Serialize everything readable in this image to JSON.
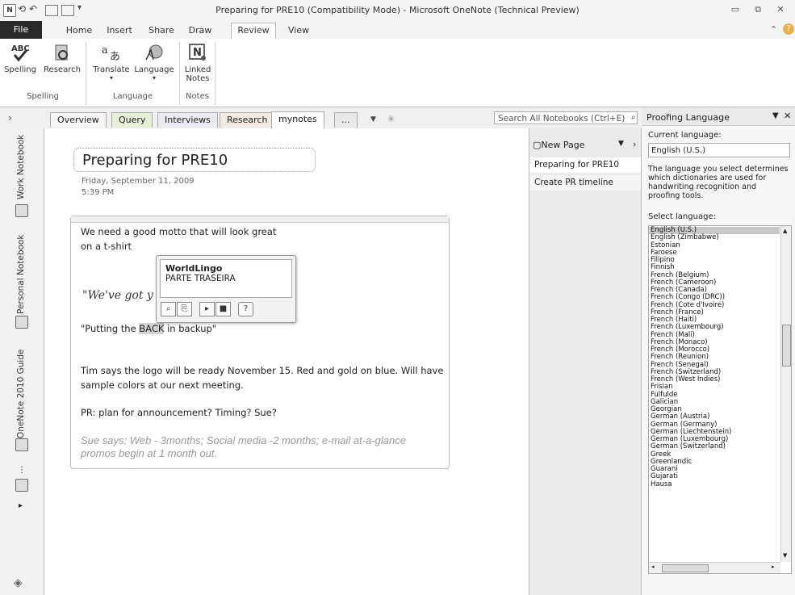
{
  "titlebar": {
    "title": "Preparing for PRE10 (Compatibility Mode) - Microsoft OneNote (Technical Preview)",
    "app_icon": "N",
    "win_minimize": "▭",
    "win_restore": "⧉",
    "win_close": "✕"
  },
  "ribbon_tabs": [
    "File",
    "Home",
    "Insert",
    "Share",
    "Draw",
    "Review",
    "View"
  ],
  "active_tab": "Review",
  "ribbon": {
    "spelling": "Spelling",
    "research": "Research",
    "translate": "Translate",
    "language": "Language",
    "linked_notes": "Linked Notes",
    "group_spelling": "Spelling",
    "group_language": "Language",
    "group_notes": "Notes"
  },
  "section_tabs": [
    "Overview",
    "Query",
    "Interviews",
    "Research",
    "mynotes",
    "..."
  ],
  "active_section": "mynotes",
  "search": {
    "placeholder": "Search All Notebooks (Ctrl+E)"
  },
  "notebooks": [
    "Work Notebook",
    "Personal Notebook",
    "OneNote 2010 Guide"
  ],
  "page": {
    "title": "Preparing for PRE10",
    "date": "Friday, September 11, 2009",
    "time": "5:39 PM"
  },
  "notes": {
    "line1": "We need a good motto that will look great",
    "line2": "on a t-shirt",
    "handwriting": "\"We've got y",
    "line3_pre": "\"Putting the ",
    "line3_sel": "BACK",
    "line3_post": " in backup\"",
    "line4": "Tim says the logo will be ready November 15. Red and gold on blue. Will have",
    "line5": "sample colors at our next meeting.",
    "line6": "PR: plan for announcement? Timing? Sue?",
    "line7": "Sue says: Web - 3months; Social media  -2 months; e-mail at-a-glance",
    "line8": "promos begin at 1 month out."
  },
  "popup": {
    "title": "WorldLingo",
    "text": "PARTE TRASEIRA"
  },
  "pagelist": {
    "new_page": "New Page",
    "pages": [
      "Preparing for PRE10",
      "Create PR timeline"
    ]
  },
  "proofing": {
    "pane_title": "Proofing Language",
    "current_label": "Current language:",
    "current_value": "English (U.S.)",
    "description": "The language you select determines which dictionaries are used for handwriting recognition and proofing tools.",
    "select_label": "Select language:",
    "languages": [
      "English (U.S.)",
      "English (Zimbabwe)",
      "Estonian",
      "Faroese",
      "Filipino",
      "Finnish",
      "French (Belgium)",
      "French (Cameroon)",
      "French (Canada)",
      "French (Congo (DRC))",
      "French (Cote d'Ivoire)",
      "French (France)",
      "French (Haiti)",
      "French (Luxembourg)",
      "French (Mali)",
      "French (Monaco)",
      "French (Morocco)",
      "French (Reunion)",
      "French (Senegal)",
      "French (Switzerland)",
      "French (West Indies)",
      "Frisian",
      "Fulfulde",
      "Galician",
      "Georgian",
      "German (Austria)",
      "German (Germany)",
      "German (Liechtenstein)",
      "German (Luxembourg)",
      "German (Switzerland)",
      "Greek",
      "Greenlandic",
      "Guarani",
      "Gujarati",
      "Hausa"
    ]
  }
}
